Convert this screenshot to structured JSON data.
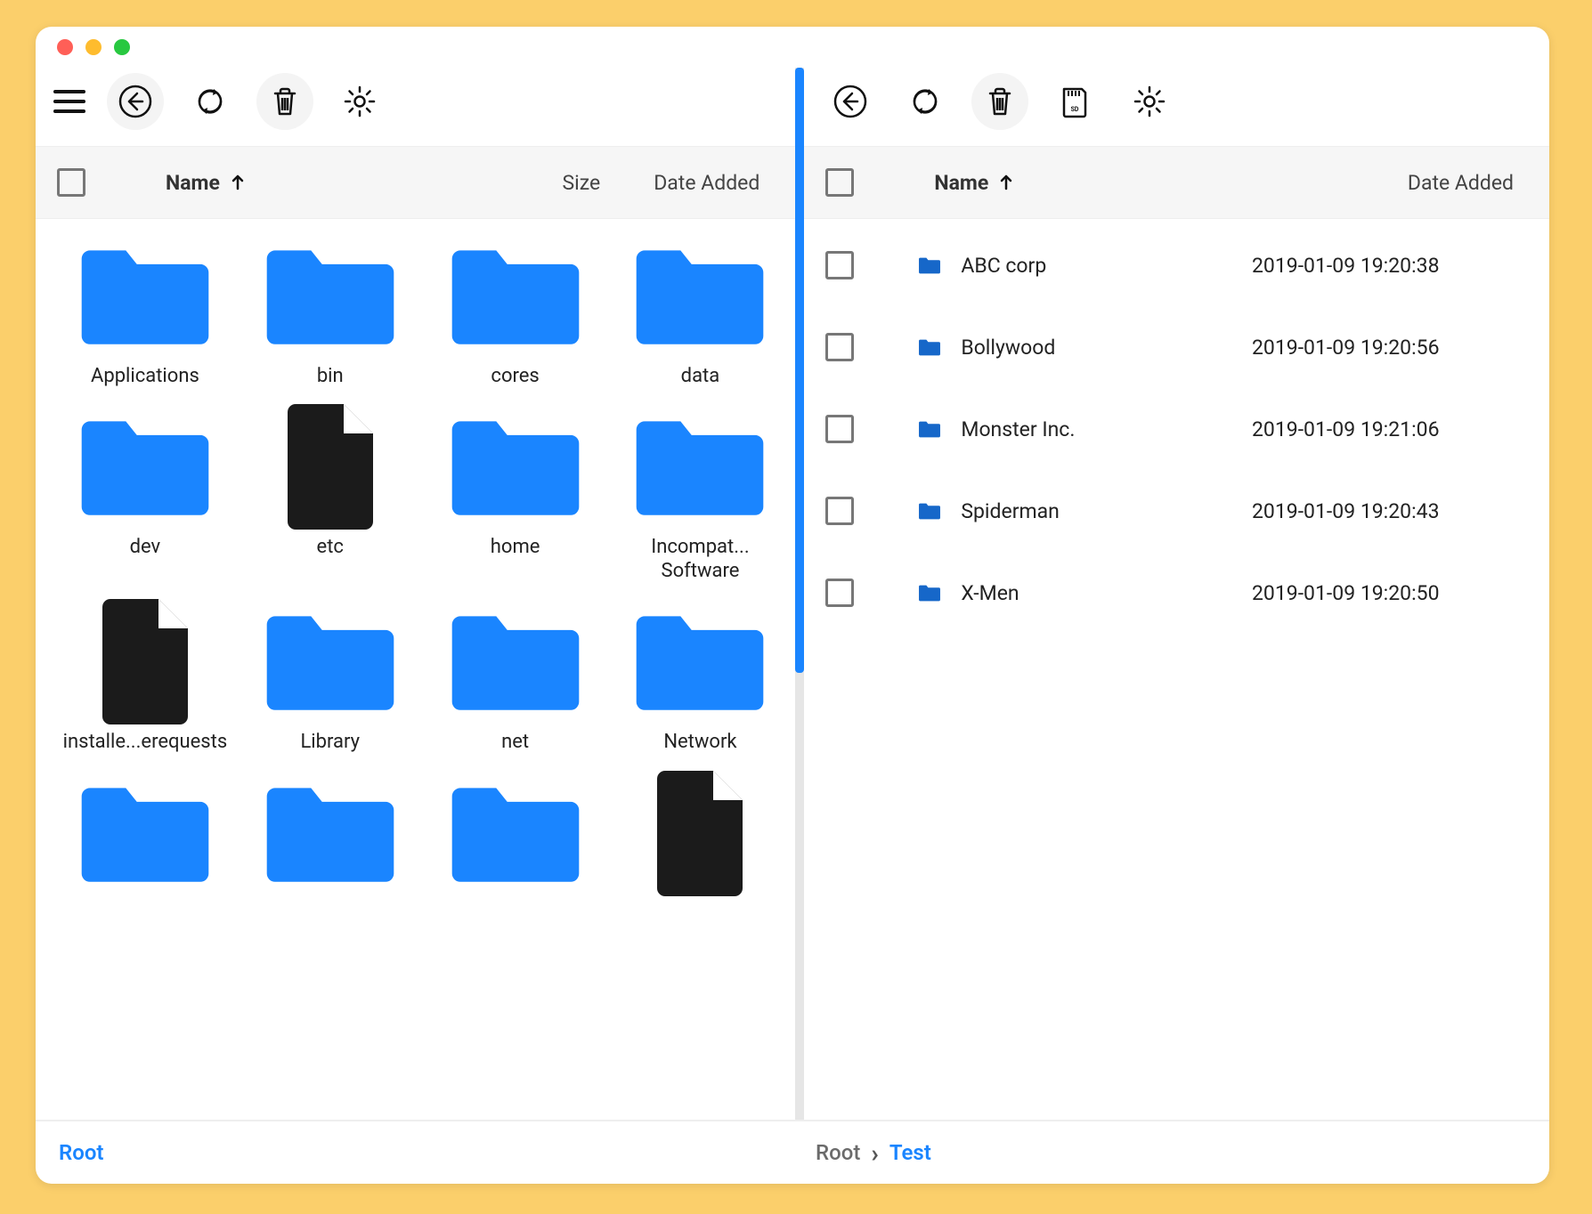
{
  "window": {
    "traffic_lights": [
      "close",
      "minimize",
      "zoom"
    ]
  },
  "left": {
    "toolbar": {
      "buttons": [
        "menu",
        "back",
        "refresh",
        "trash",
        "settings"
      ]
    },
    "columns": {
      "name": "Name",
      "size": "Size",
      "date": "Date Added",
      "sort": "asc"
    },
    "grid": [
      {
        "type": "folder",
        "label": "Applications"
      },
      {
        "type": "folder",
        "label": "bin"
      },
      {
        "type": "folder",
        "label": "cores"
      },
      {
        "type": "folder",
        "label": "data"
      },
      {
        "type": "folder",
        "label": "dev"
      },
      {
        "type": "file",
        "label": "etc"
      },
      {
        "type": "folder",
        "label": "home"
      },
      {
        "type": "folder",
        "label": "Incompat... Software"
      },
      {
        "type": "file",
        "label": "installe...erequests"
      },
      {
        "type": "folder",
        "label": "Library"
      },
      {
        "type": "folder",
        "label": "net"
      },
      {
        "type": "folder",
        "label": "Network"
      },
      {
        "type": "folder",
        "label": ""
      },
      {
        "type": "folder",
        "label": ""
      },
      {
        "type": "folder",
        "label": ""
      },
      {
        "type": "file",
        "label": ""
      }
    ],
    "breadcrumb": [
      "Root"
    ]
  },
  "right": {
    "toolbar": {
      "buttons": [
        "back",
        "refresh",
        "trash",
        "sdcard",
        "settings"
      ]
    },
    "columns": {
      "name": "Name",
      "date": "Date Added",
      "sort": "asc"
    },
    "rows": [
      {
        "type": "folder",
        "name": "ABC corp",
        "date": "2019-01-09 19:20:38"
      },
      {
        "type": "folder",
        "name": "Bollywood",
        "date": "2019-01-09 19:20:56"
      },
      {
        "type": "folder",
        "name": "Monster Inc.",
        "date": "2019-01-09 19:21:06"
      },
      {
        "type": "folder",
        "name": "Spiderman",
        "date": "2019-01-09 19:20:43"
      },
      {
        "type": "folder",
        "name": "X-Men",
        "date": "2019-01-09 19:20:50"
      }
    ],
    "breadcrumb": [
      "Root",
      "Test"
    ]
  }
}
